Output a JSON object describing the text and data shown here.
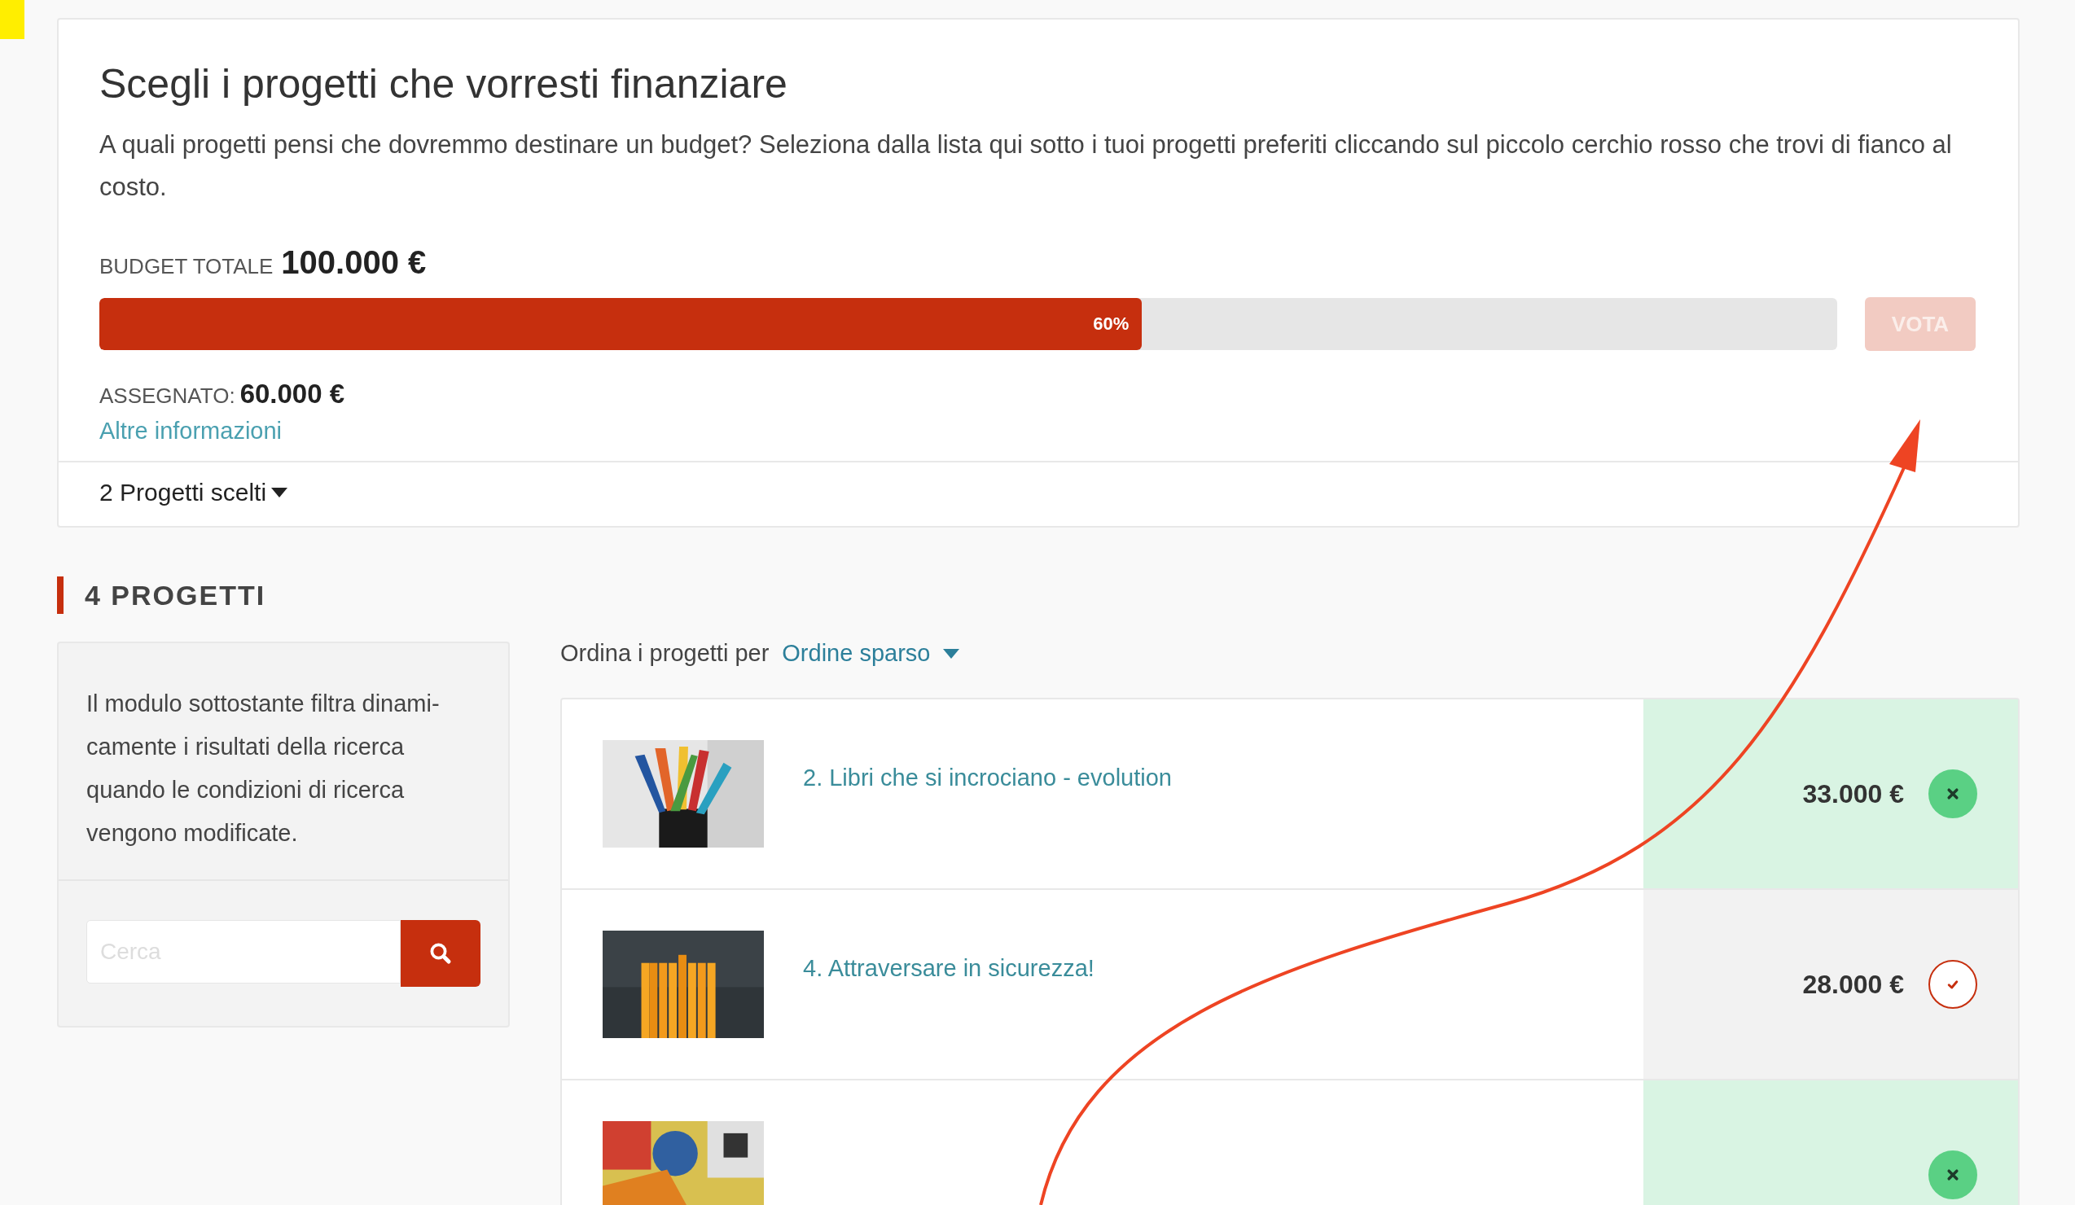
{
  "header": {
    "title": "Scegli i progetti che vorresti finanziare",
    "description": "A quali progetti pensi che dovremmo destinare un budget? Seleziona dalla lista qui sotto i tuoi progetti preferiti cliccando sul piccolo cerchio rosso che trovi di fianco al costo.",
    "budget_label": "BUDGET TOTALE",
    "budget_value": "100.000 €",
    "progress": {
      "level": 0.6,
      "label": "60%"
    },
    "vote_button": {
      "label": "VOTA",
      "disabled": true
    },
    "assigned_label": "ASSEGNATO:",
    "assigned_value": "60.000 €",
    "more_info_link": "Altre informazioni",
    "chosen_toggle": "2 Progetti scelti"
  },
  "section": {
    "title": "4 PROGETTI"
  },
  "filter": {
    "text": "Il modulo sottostante filtra dinami-camente i risultati della ricerca quando le condizioni di ricerca vengono modificate.",
    "search": {
      "placeholder": "Cerca"
    }
  },
  "sort": {
    "label": "Ordina i progetti per",
    "value": "Ordine sparso"
  },
  "projects": [
    {
      "title": "2. Libri che si incrociano - evolution",
      "price": "33.000 €",
      "selected": true,
      "kind": "picture"
    },
    {
      "title": "4. Attraversare in sicurezza!",
      "price": "28.000 €",
      "selected": false,
      "kind": "picture"
    },
    {
      "selected": true,
      "kind": "picture"
    }
  ]
}
